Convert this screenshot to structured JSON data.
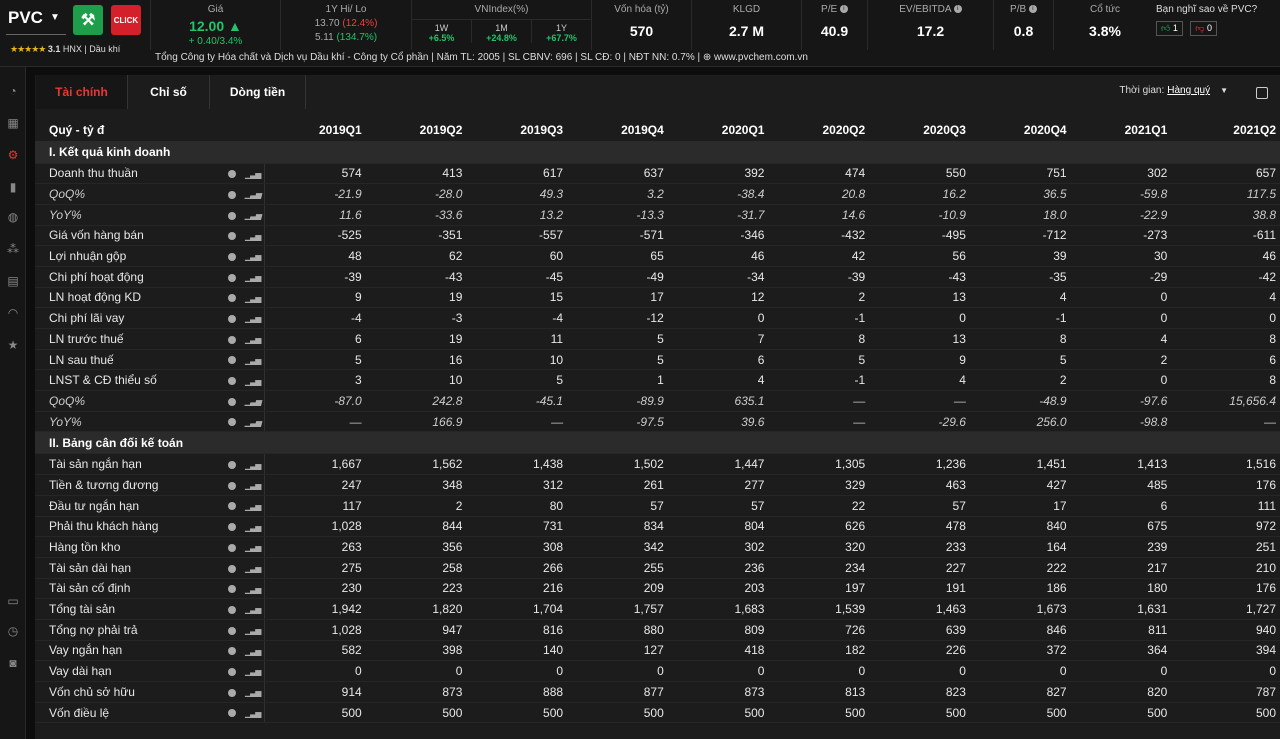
{
  "header": {
    "ticker": "PVC",
    "rating": "3.1",
    "exchange": "HNX | Dầu khí",
    "stars": "★★★★★",
    "logo2_text": "CLICK",
    "price_label": "Giá",
    "price": "12.00",
    "price_change": "+ 0.40/3.4%",
    "hilo_label": "1Y Hi/ Lo",
    "hi": "13.70",
    "hi_pct": "(12.4%)",
    "lo": "5.11",
    "lo_pct": "(134.7%)",
    "vni_label": "VNIndex(%)",
    "vni": [
      {
        "p": "1W",
        "v": "+6.5%"
      },
      {
        "p": "1M",
        "v": "+24.8%"
      },
      {
        "p": "1Y",
        "v": "+67.7%"
      }
    ],
    "metrics": [
      {
        "label": "Vốn hóa (tỷ)",
        "value": "570"
      },
      {
        "label": "KLGD",
        "value": "2.7 M"
      },
      {
        "label": "P/E",
        "value": "40.9"
      },
      {
        "label": "EV/EBITDA",
        "value": "17.2"
      },
      {
        "label": "P/B",
        "value": "0.8"
      },
      {
        "label": "Cổ tức",
        "value": "3.8%"
      }
    ],
    "poll_label": "Bạn nghĩ sao về PVC?",
    "poll_up": "1",
    "poll_down": "0",
    "info": "Tổng Công ty Hóa chất và Dịch vụ Dầu khí - Công ty Cổ phần | Năm TL: 2005 | SL CBNV: 696 | SL CĐ: 0 | NĐT NN: 0.7% | ⊕ www.pvchem.com.vn"
  },
  "tabs": [
    "Tài chính",
    "Chỉ số",
    "Dòng tiền"
  ],
  "period": {
    "label": "Thời gian:",
    "value": "Hàng quý"
  },
  "table": {
    "head": "Quý - tỷ đ",
    "columns": [
      "2019Q1",
      "2019Q2",
      "2019Q3",
      "2019Q4",
      "2020Q1",
      "2020Q2",
      "2020Q3",
      "2020Q4",
      "2021Q1",
      "2021Q2"
    ],
    "rows": [
      {
        "sec": "I. Kết quả kinh doanh"
      },
      {
        "label": "Doanh thu thuần",
        "v": [
          "574",
          "413",
          "617",
          "637",
          "392",
          "474",
          "550",
          "751",
          "302",
          "657"
        ]
      },
      {
        "label": "QoQ%",
        "it": true,
        "v": [
          "-21.9",
          "-28.0",
          "49.3",
          "3.2",
          "-38.4",
          "20.8",
          "16.2",
          "36.5",
          "-59.8",
          "117.5"
        ]
      },
      {
        "label": "YoY%",
        "it": true,
        "v": [
          "11.6",
          "-33.6",
          "13.2",
          "-13.3",
          "-31.7",
          "14.6",
          "-10.9",
          "18.0",
          "-22.9",
          "38.8"
        ]
      },
      {
        "label": "Giá vốn hàng bán",
        "v": [
          "-525",
          "-351",
          "-557",
          "-571",
          "-346",
          "-432",
          "-495",
          "-712",
          "-273",
          "-611"
        ]
      },
      {
        "label": "Lợi nhuận gộp",
        "v": [
          "48",
          "62",
          "60",
          "65",
          "46",
          "42",
          "56",
          "39",
          "30",
          "46"
        ]
      },
      {
        "label": "Chi phí hoạt động",
        "v": [
          "-39",
          "-43",
          "-45",
          "-49",
          "-34",
          "-39",
          "-43",
          "-35",
          "-29",
          "-42"
        ]
      },
      {
        "label": "LN hoạt động KD",
        "v": [
          "9",
          "19",
          "15",
          "17",
          "12",
          "2",
          "13",
          "4",
          "0",
          "4"
        ]
      },
      {
        "label": "Chi phí lãi vay",
        "v": [
          "-4",
          "-3",
          "-4",
          "-12",
          "0",
          "-1",
          "0",
          "-1",
          "0",
          "0"
        ]
      },
      {
        "label": "LN trước thuế",
        "v": [
          "6",
          "19",
          "11",
          "5",
          "7",
          "8",
          "13",
          "8",
          "4",
          "8"
        ]
      },
      {
        "label": "LN sau thuế",
        "v": [
          "5",
          "16",
          "10",
          "5",
          "6",
          "5",
          "9",
          "5",
          "2",
          "6"
        ]
      },
      {
        "label": "LNST & CĐ thiểu số",
        "v": [
          "3",
          "10",
          "5",
          "1",
          "4",
          "-1",
          "4",
          "2",
          "0",
          "8"
        ]
      },
      {
        "label": "QoQ%",
        "it": true,
        "v": [
          "-87.0",
          "242.8",
          "-45.1",
          "-89.9",
          "635.1",
          "—",
          "—",
          "-48.9",
          "-97.6",
          "15,656.4"
        ]
      },
      {
        "label": "YoY%",
        "it": true,
        "v": [
          "—",
          "166.9",
          "—",
          "-97.5",
          "39.6",
          "—",
          "-29.6",
          "256.0",
          "-98.8",
          "—"
        ]
      },
      {
        "sec": "II. Bảng cân đối kế toán"
      },
      {
        "label": "Tài sản ngắn hạn",
        "v": [
          "1,667",
          "1,562",
          "1,438",
          "1,502",
          "1,447",
          "1,305",
          "1,236",
          "1,451",
          "1,413",
          "1,516"
        ]
      },
      {
        "label": "Tiền & tương đương",
        "v": [
          "247",
          "348",
          "312",
          "261",
          "277",
          "329",
          "463",
          "427",
          "485",
          "176"
        ]
      },
      {
        "label": "Đầu tư ngắn hạn",
        "v": [
          "117",
          "2",
          "80",
          "57",
          "57",
          "22",
          "57",
          "17",
          "6",
          "111"
        ]
      },
      {
        "label": "Phải thu khách hàng",
        "v": [
          "1,028",
          "844",
          "731",
          "834",
          "804",
          "626",
          "478",
          "840",
          "675",
          "972"
        ]
      },
      {
        "label": "Hàng tồn kho",
        "v": [
          "263",
          "356",
          "308",
          "342",
          "302",
          "320",
          "233",
          "164",
          "239",
          "251"
        ]
      },
      {
        "label": "Tài sản dài hạn",
        "v": [
          "275",
          "258",
          "266",
          "255",
          "236",
          "234",
          "227",
          "222",
          "217",
          "210"
        ]
      },
      {
        "label": "Tài sản cố định",
        "v": [
          "230",
          "223",
          "216",
          "209",
          "203",
          "197",
          "191",
          "186",
          "180",
          "176"
        ]
      },
      {
        "label": "Tổng tài sản",
        "v": [
          "1,942",
          "1,820",
          "1,704",
          "1,757",
          "1,683",
          "1,539",
          "1,463",
          "1,673",
          "1,631",
          "1,727"
        ]
      },
      {
        "label": "Tổng nợ phải trả",
        "v": [
          "1,028",
          "947",
          "816",
          "880",
          "809",
          "726",
          "639",
          "846",
          "811",
          "940"
        ]
      },
      {
        "label": "Vay ngắn hạn",
        "v": [
          "582",
          "398",
          "140",
          "127",
          "418",
          "182",
          "226",
          "372",
          "364",
          "394"
        ]
      },
      {
        "label": "Vay dài hạn",
        "v": [
          "0",
          "0",
          "0",
          "0",
          "0",
          "0",
          "0",
          "0",
          "0",
          "0"
        ]
      },
      {
        "label": "Vốn chủ sở hữu",
        "v": [
          "914",
          "873",
          "888",
          "877",
          "873",
          "813",
          "823",
          "827",
          "820",
          "787"
        ]
      },
      {
        "label": "Vốn điều lệ",
        "v": [
          "500",
          "500",
          "500",
          "500",
          "500",
          "500",
          "500",
          "500",
          "500",
          "500"
        ]
      }
    ]
  }
}
